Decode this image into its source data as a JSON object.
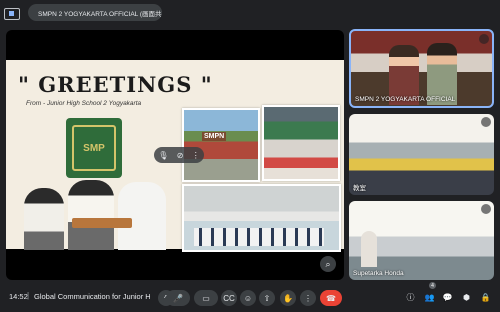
{
  "topbar": {
    "present_label": "SMPN 2 YOGYAKARTA OFFICIAL (画面共有)"
  },
  "stage": {
    "slide_title": "\" GREETINGS \"",
    "slide_subtitle": "From - Junior High School 2 Yogyakarta",
    "logo_text": "SMP",
    "sign_text": "SMPN"
  },
  "tiles": [
    {
      "name": "SMPN 2 YOGYAKARTA OFFICIAL"
    },
    {
      "name": "教室"
    },
    {
      "name": "Supetarka Honda"
    }
  ],
  "bottombar": {
    "time": "14:52",
    "meeting_title": "Global Communication for Junior Hig...",
    "participants_count": "4"
  },
  "colors": {
    "end_call": "#ea4335",
    "active_speaker_border": "#8ab4f8",
    "background": "#202124"
  }
}
